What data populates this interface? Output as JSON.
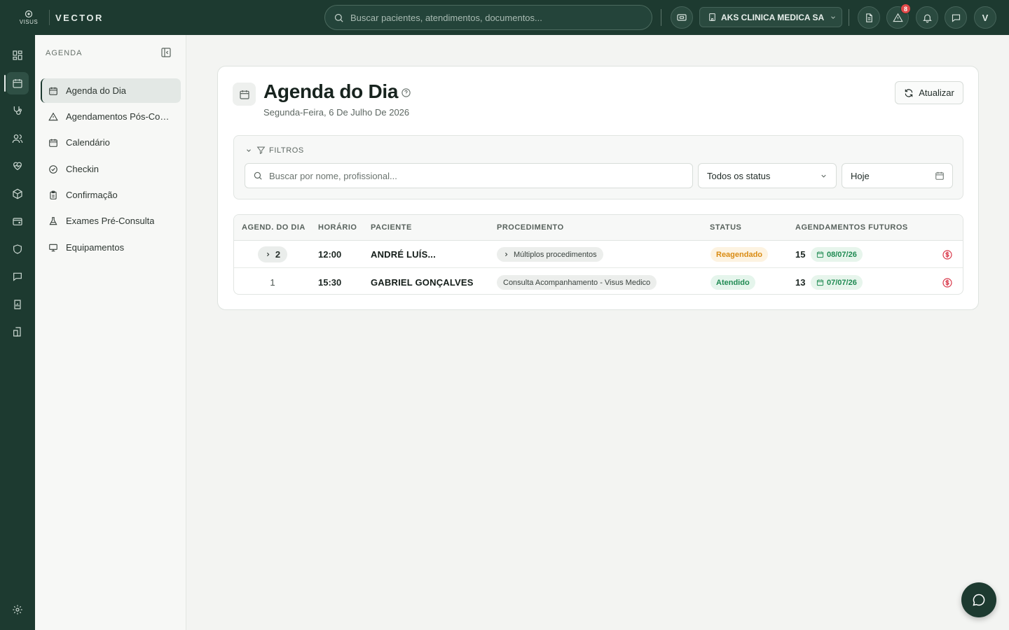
{
  "topbar": {
    "logo_text": "VISUS",
    "brand": "VECTOR",
    "search_placeholder": "Buscar pacientes, atendimentos, documentos...",
    "clinic": "AKS CLINICA MEDICA SA",
    "alerts_count": "8",
    "user_initial": "V"
  },
  "sidebar": {
    "heading": "AGENDA",
    "items": [
      {
        "label": "Agenda do Dia",
        "icon": "calendar-grid-icon"
      },
      {
        "label": "Agendamentos Pós-Consulta",
        "icon": "warning-icon"
      },
      {
        "label": "Calendário",
        "icon": "calendar-grid-icon"
      },
      {
        "label": "Checkin",
        "icon": "check-circle-icon"
      },
      {
        "label": "Confirmação",
        "icon": "clipboard-icon"
      },
      {
        "label": "Exames Pré-Consulta",
        "icon": "flask-icon"
      },
      {
        "label": "Equipamentos",
        "icon": "monitor-icon"
      }
    ]
  },
  "main": {
    "title": "Agenda do Dia",
    "date": "Segunda-Feira, 6 De Julho De 2026",
    "refresh_label": "Atualizar",
    "filters": {
      "label": "FILTROS",
      "search_placeholder": "Buscar por nome, profissional...",
      "status_value": "Todos os status",
      "date_value": "Hoje"
    },
    "table": {
      "columns": [
        "AGEND. DO DIA",
        "HORÁRIO",
        "PACIENTE",
        "PROCEDIMENTO",
        "STATUS",
        "AGENDAMENTOS FUTUROS"
      ],
      "rows": [
        {
          "agend": "2",
          "time": "12:00",
          "patient": "ANDRÉ LUÍS...",
          "procedure": "Múltiplos procedimentos",
          "status": "Reagendado",
          "future_count": "15",
          "future_date": "08/07/26"
        },
        {
          "agend": "1",
          "time": "15:30",
          "patient": "GABRIEL GONÇALVES",
          "procedure": "Consulta Acompanhamento - Visus Medico",
          "status": "Atendido",
          "future_count": "13",
          "future_date": "07/07/26"
        }
      ]
    }
  },
  "colors": {
    "brand_dark": "#1d3a30",
    "status_reagendado": "#d98b12",
    "status_atendido": "#1f8a52",
    "alert_badge": "#e04848",
    "billing_icon": "#d9384a"
  }
}
